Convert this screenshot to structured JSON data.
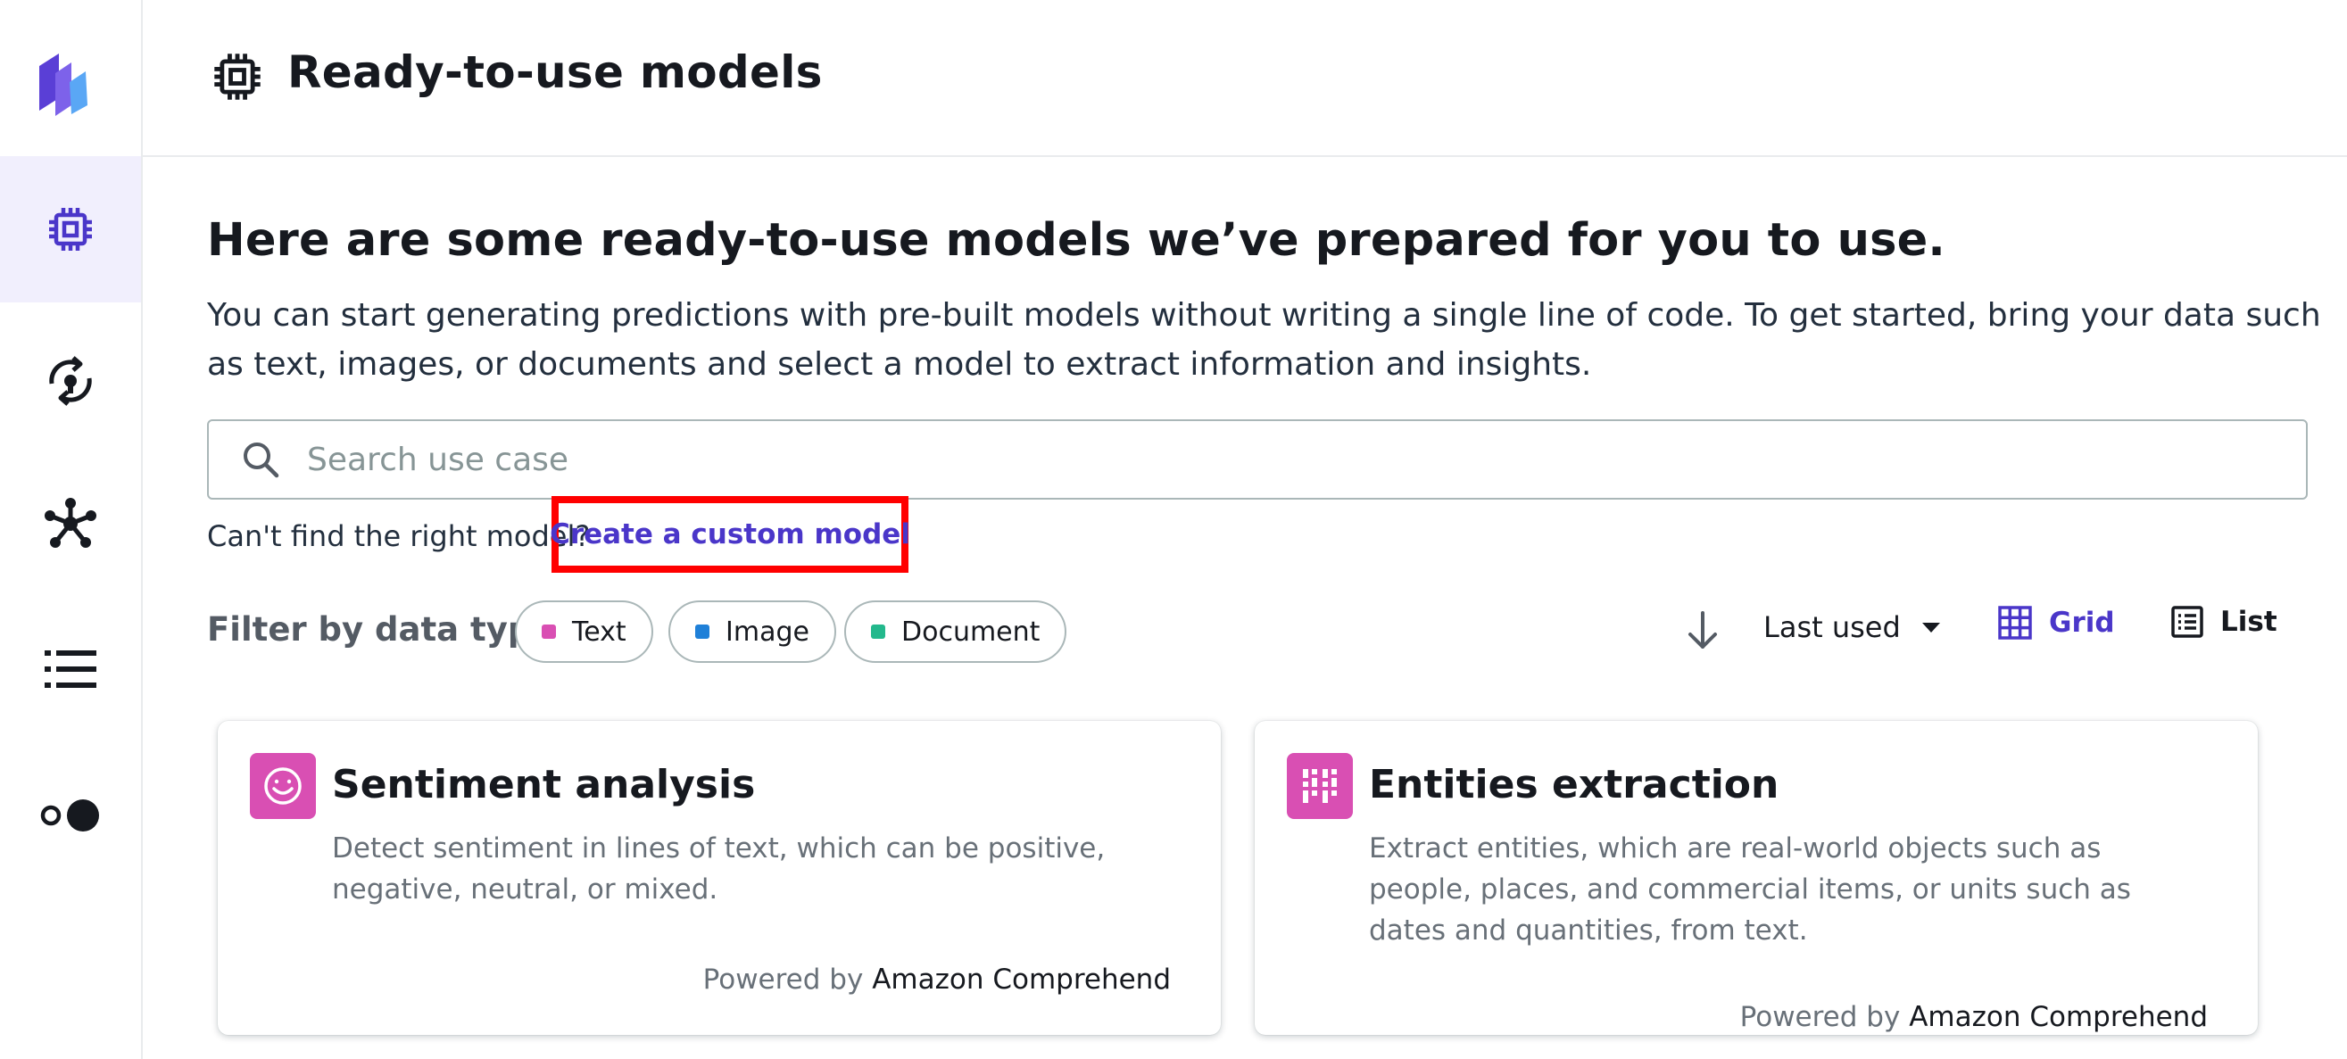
{
  "rail": {
    "items": [
      {
        "name": "ready-to-use-models",
        "active": true
      },
      {
        "name": "my-models"
      },
      {
        "name": "datasets"
      },
      {
        "name": "logs"
      },
      {
        "name": "settings"
      }
    ]
  },
  "header": {
    "title": "Ready-to-use models"
  },
  "main": {
    "heading": "Here are some ready-to-use models we’ve prepared for you to use.",
    "description": "You can start generating predictions with pre-built models without writing a single line of code. To get started, bring your data such as text, images, or documents and select a model to extract information and insights.",
    "search": {
      "placeholder": "Search use case",
      "value": ""
    },
    "cant_find": "Can't find the right model?",
    "custom_link": "Create a custom model",
    "filter": {
      "label": "Filter by data type:",
      "chips": [
        {
          "label": "Text",
          "color": "#d94fb3"
        },
        {
          "label": "Image",
          "color": "#1f80d8"
        },
        {
          "label": "Document",
          "color": "#23b88c"
        }
      ]
    },
    "sort": {
      "value": "Last used"
    },
    "view": {
      "grid_label": "Grid",
      "list_label": "List",
      "selected": "Grid"
    }
  },
  "cards": [
    {
      "title": "Sentiment analysis",
      "description": "Detect sentiment in lines of text, which can be positive, negative, neutral, or mixed.",
      "powered_by": "Powered by",
      "provider": "Amazon Comprehend",
      "icon": "smiley-icon"
    },
    {
      "title": "Entities extraction",
      "description": "Extract entities, which are real-world objects such as people, places, and commercial items, or units such as dates and quantities, from text.",
      "powered_by": "Powered by",
      "provider": "Amazon Comprehend",
      "icon": "entities-grid-icon"
    }
  ],
  "colors": {
    "accent": "#4a36c9",
    "highlight_box": "#ff0000",
    "card_icon_bg": "#d94fb3"
  }
}
